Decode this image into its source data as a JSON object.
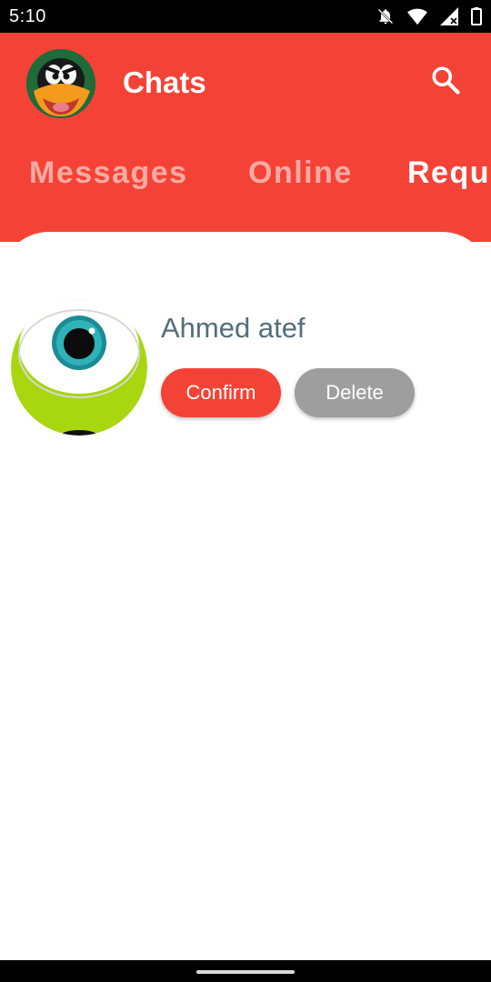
{
  "status_bar": {
    "time": "5:10",
    "icons": [
      "notifications-off-icon",
      "wifi-icon",
      "signal-icon",
      "battery-icon"
    ]
  },
  "header": {
    "title": "Chats",
    "avatar": "daffy-duck-avatar",
    "search_icon": "search-icon",
    "background_color": "#f44336"
  },
  "tabs": [
    {
      "label": "Messages",
      "active": false
    },
    {
      "label": "Online",
      "active": false
    },
    {
      "label": "Requests",
      "active": true
    }
  ],
  "requests": [
    {
      "name": "Ahmed atef",
      "avatar": "one-eyed-monster-avatar",
      "confirm_label": "Confirm",
      "delete_label": "Delete"
    }
  ],
  "colors": {
    "accent": "#f44336",
    "delete_button": "#9e9e9e",
    "name_text": "#546e7a"
  }
}
